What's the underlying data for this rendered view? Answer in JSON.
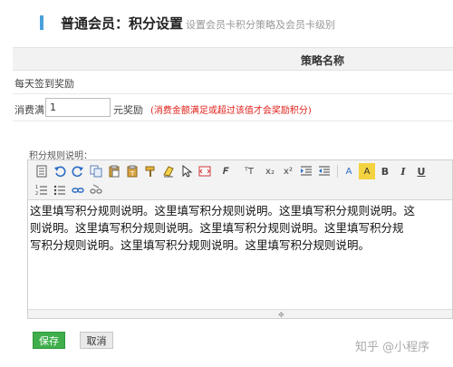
{
  "header": {
    "title": "普通会员：积分设置",
    "subtitle": "设置会员卡积分策略及会员卡级别"
  },
  "table": {
    "column_header": "策略名称"
  },
  "rows": {
    "daily_checkin": "每天签到奖励",
    "spend_label": "消费满",
    "spend_value": "1",
    "spend_unit": "元奖励",
    "spend_hint": "(消费金额满足或超过该值才会奖励积分)"
  },
  "editor": {
    "label": "积分规则说明：",
    "lines": [
      "这里填写积分规则说明。这里填写积分规则说明。这里填写积分规则说明。这",
      "则说明。这里填写积分规则说明。这里填写积分规则说明。这里填写积分规",
      "写积分规则说明。这里填写积分规则说明。这里填写积分规则说明。"
    ],
    "toolbar": {
      "font_family": "𝑭",
      "font_size": "ᵀT",
      "subscript": "x₂",
      "superscript": "x²",
      "font_color": "A",
      "bg_color": "A",
      "bold": "B",
      "italic": "I",
      "underline": "U"
    }
  },
  "buttons": {
    "save": "保存",
    "cancel": "取消"
  },
  "watermark": "知乎 @小程序",
  "colors": {
    "accent": "#4aa1d8",
    "save_button": "#3fae4b",
    "hint_red": "#e0211a"
  }
}
